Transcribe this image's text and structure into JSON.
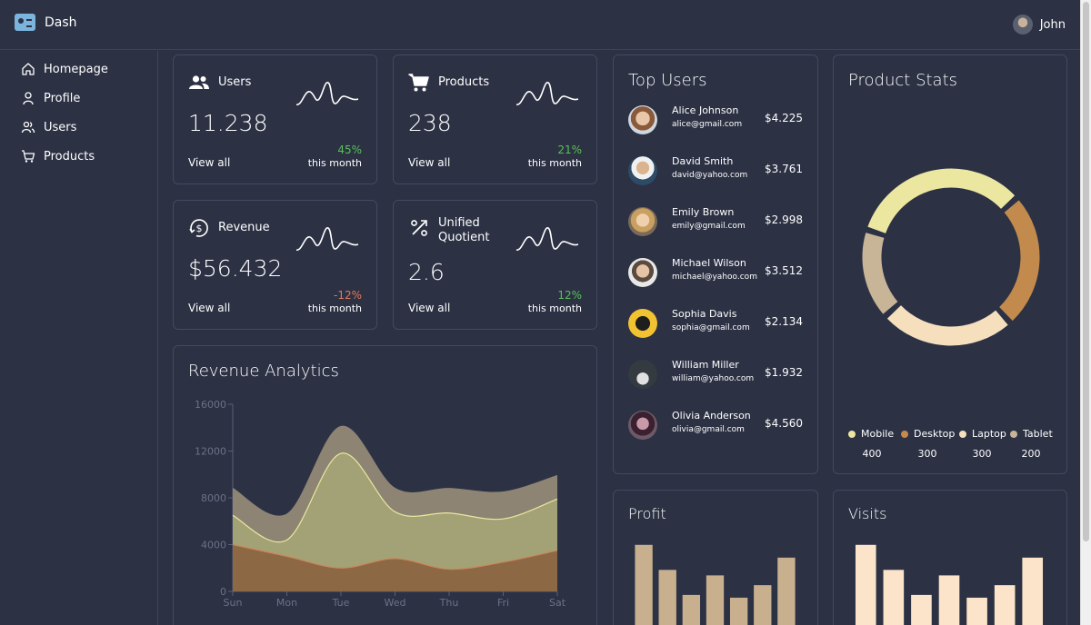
{
  "app": {
    "title": "Dash"
  },
  "user": {
    "name": "John"
  },
  "sidebar": {
    "items": [
      {
        "label": "Homepage",
        "icon": "home-icon"
      },
      {
        "label": "Profile",
        "icon": "person-icon"
      },
      {
        "label": "Users",
        "icon": "users-icon"
      },
      {
        "label": "Products",
        "icon": "cart-icon"
      }
    ]
  },
  "stats": [
    {
      "title": "Users",
      "icon": "users-icon",
      "value": "11.238",
      "change": "45%",
      "change_dir": "up",
      "period": "this month",
      "link": "View all"
    },
    {
      "title": "Products",
      "icon": "cart-icon",
      "value": "238",
      "change": "21%",
      "change_dir": "up",
      "period": "this month",
      "link": "View all"
    },
    {
      "title": "Revenue",
      "icon": "dollar-cycle-icon",
      "value": "$56.432",
      "change": "-12%",
      "change_dir": "down",
      "period": "this month",
      "link": "View all"
    },
    {
      "title": "Unified Quotient",
      "title_lines": [
        "Unified",
        "Quotient"
      ],
      "icon": "percent-icon",
      "value": "2.6",
      "change": "12%",
      "change_dir": "up",
      "period": "this month",
      "link": "View all"
    }
  ],
  "top_users": {
    "title": "Top Users",
    "users": [
      {
        "name": "Alice Johnson",
        "email": "alice@gmail.com",
        "amount": "$4.225"
      },
      {
        "name": "David Smith",
        "email": "david@yahoo.com",
        "amount": "$3.761"
      },
      {
        "name": "Emily Brown",
        "email": "emily@gmail.com",
        "amount": "$2.998"
      },
      {
        "name": "Michael Wilson",
        "email": "michael@yahoo.com",
        "amount": "$3.512"
      },
      {
        "name": "Sophia Davis",
        "email": "sophia@gmail.com",
        "amount": "$2.134"
      },
      {
        "name": "William Miller",
        "email": "william@yahoo.com",
        "amount": "$1.932"
      },
      {
        "name": "Olivia Anderson",
        "email": "olivia@gmail.com",
        "amount": "$4.560"
      }
    ]
  },
  "product_stats": {
    "title": "Product Stats",
    "chart_data": {
      "type": "pie",
      "labels": [
        "Mobile",
        "Desktop",
        "Laptop",
        "Tablet"
      ],
      "values": [
        400,
        300,
        300,
        200
      ],
      "value_labels": [
        "400",
        "300",
        "300",
        "200"
      ],
      "colors": [
        "#ece7a0",
        "#c28a4c",
        "#f6dfbd",
        "#c8b496"
      ],
      "legend": "bottom"
    }
  },
  "revenue_analytics": {
    "title": "Revenue Analytics",
    "chart_data": {
      "type": "area",
      "categories": [
        "Sun",
        "Mon",
        "Tue",
        "Wed",
        "Thu",
        "Fri",
        "Sat"
      ],
      "y_ticks": [
        "0",
        "4000",
        "8000",
        "12000",
        "16000"
      ],
      "ylim": [
        0,
        16000
      ],
      "stacked": true,
      "series": [
        {
          "values": [
            4000,
            3000,
            2000,
            2800,
            1900,
            2500,
            3500
          ],
          "color": "#8c6845"
        },
        {
          "values": [
            2500,
            1400,
            9800,
            4000,
            4800,
            3700,
            4400
          ],
          "color": "#a3a276"
        },
        {
          "values": [
            2300,
            2200,
            2300,
            2000,
            2100,
            2300,
            2000
          ],
          "color": "#8d8474"
        }
      ]
    }
  },
  "profit": {
    "title": "Profit",
    "chart_data": {
      "type": "bar",
      "values": [
        4000,
        3000,
        2000,
        2780,
        1890,
        2390,
        3490
      ],
      "ylim": [
        0,
        4500
      ],
      "color": "#c8b08f"
    }
  },
  "visits": {
    "title": "Visits",
    "chart_data": {
      "type": "bar",
      "values": [
        4000,
        3000,
        2000,
        2780,
        1890,
        2390,
        3490
      ],
      "ylim": [
        0,
        4500
      ],
      "color": "#fbe4c9"
    }
  },
  "colors": {
    "background": "#2c3144",
    "border": "#434962",
    "positive": "#57c257",
    "negative": "#e07a59"
  }
}
